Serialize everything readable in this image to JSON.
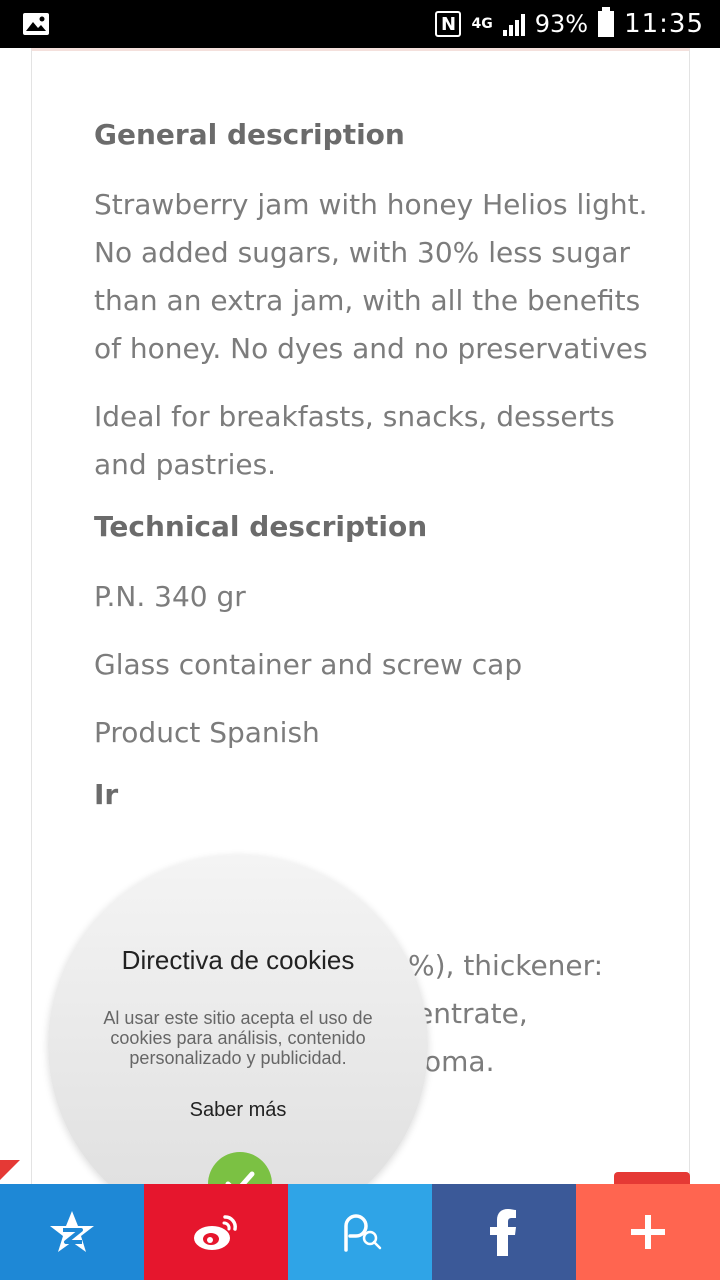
{
  "status_bar": {
    "network": "4G",
    "battery": "93%",
    "time": "11:35"
  },
  "product": {
    "general_heading": "General description",
    "general_p1": "Strawberry jam with honey Helios light.\nNo added sugars, with 30% less sugar than an extra jam, with all the benefits of honey. No dyes and no preservatives",
    "general_p2": "Ideal for breakfasts, snacks, desserts and pastries.",
    "technical_heading": "Technical description",
    "tech_items": [
      "P.N. 340 gr",
      "Glass container and screw cap",
      "Product Spanish"
    ],
    "ingredients_partial_heading": "Ir",
    "ingredients_visible": [
      "%), thickener:",
      "entrate,",
      "oma."
    ]
  },
  "cookie_popup": {
    "title": "Directiva de cookies",
    "text": "Al usar este sitio acepta el uso de cookies para análisis, contenido personalizado y publicidad.",
    "more_link": "Saber más"
  },
  "share_bar": {
    "buttons": [
      {
        "name": "qzone",
        "icon": "qzone-star-icon",
        "color": "#1e88d6"
      },
      {
        "name": "weibo",
        "icon": "weibo-icon",
        "color": "#e6162d"
      },
      {
        "name": "pinyou",
        "icon": "pinyou-icon",
        "color": "#2fa4e7"
      },
      {
        "name": "facebook",
        "icon": "facebook-icon",
        "color": "#3b5998"
      },
      {
        "name": "more",
        "icon": "plus-icon",
        "color": "#ff6550"
      }
    ]
  }
}
